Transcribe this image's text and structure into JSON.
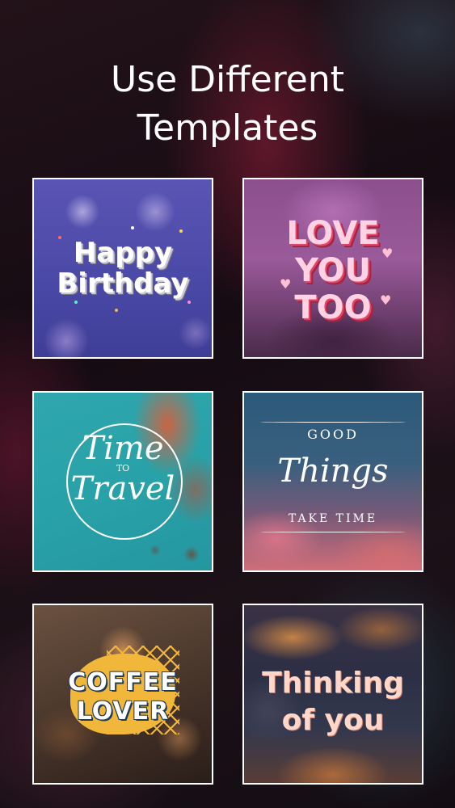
{
  "header": {
    "title_line1": "Use Different",
    "title_line2": "Templates"
  },
  "templates": [
    {
      "lines": [
        "Happy",
        "Birthday"
      ]
    },
    {
      "lines": [
        "LOVE",
        "YOU",
        "TOO"
      ]
    },
    {
      "lines": [
        "Time",
        "TO",
        "Travel"
      ]
    },
    {
      "lines": [
        "GOOD",
        "Things",
        "TAKE TIME"
      ]
    },
    {
      "lines": [
        "COFFEE",
        "LOVER"
      ]
    },
    {
      "lines": [
        "Thinking",
        "of you"
      ]
    }
  ],
  "colors": {
    "title": "#ffffff",
    "card_border": "#ffffff",
    "love_accent": "#e0456a",
    "coffee_accent": "#f1b73a"
  }
}
